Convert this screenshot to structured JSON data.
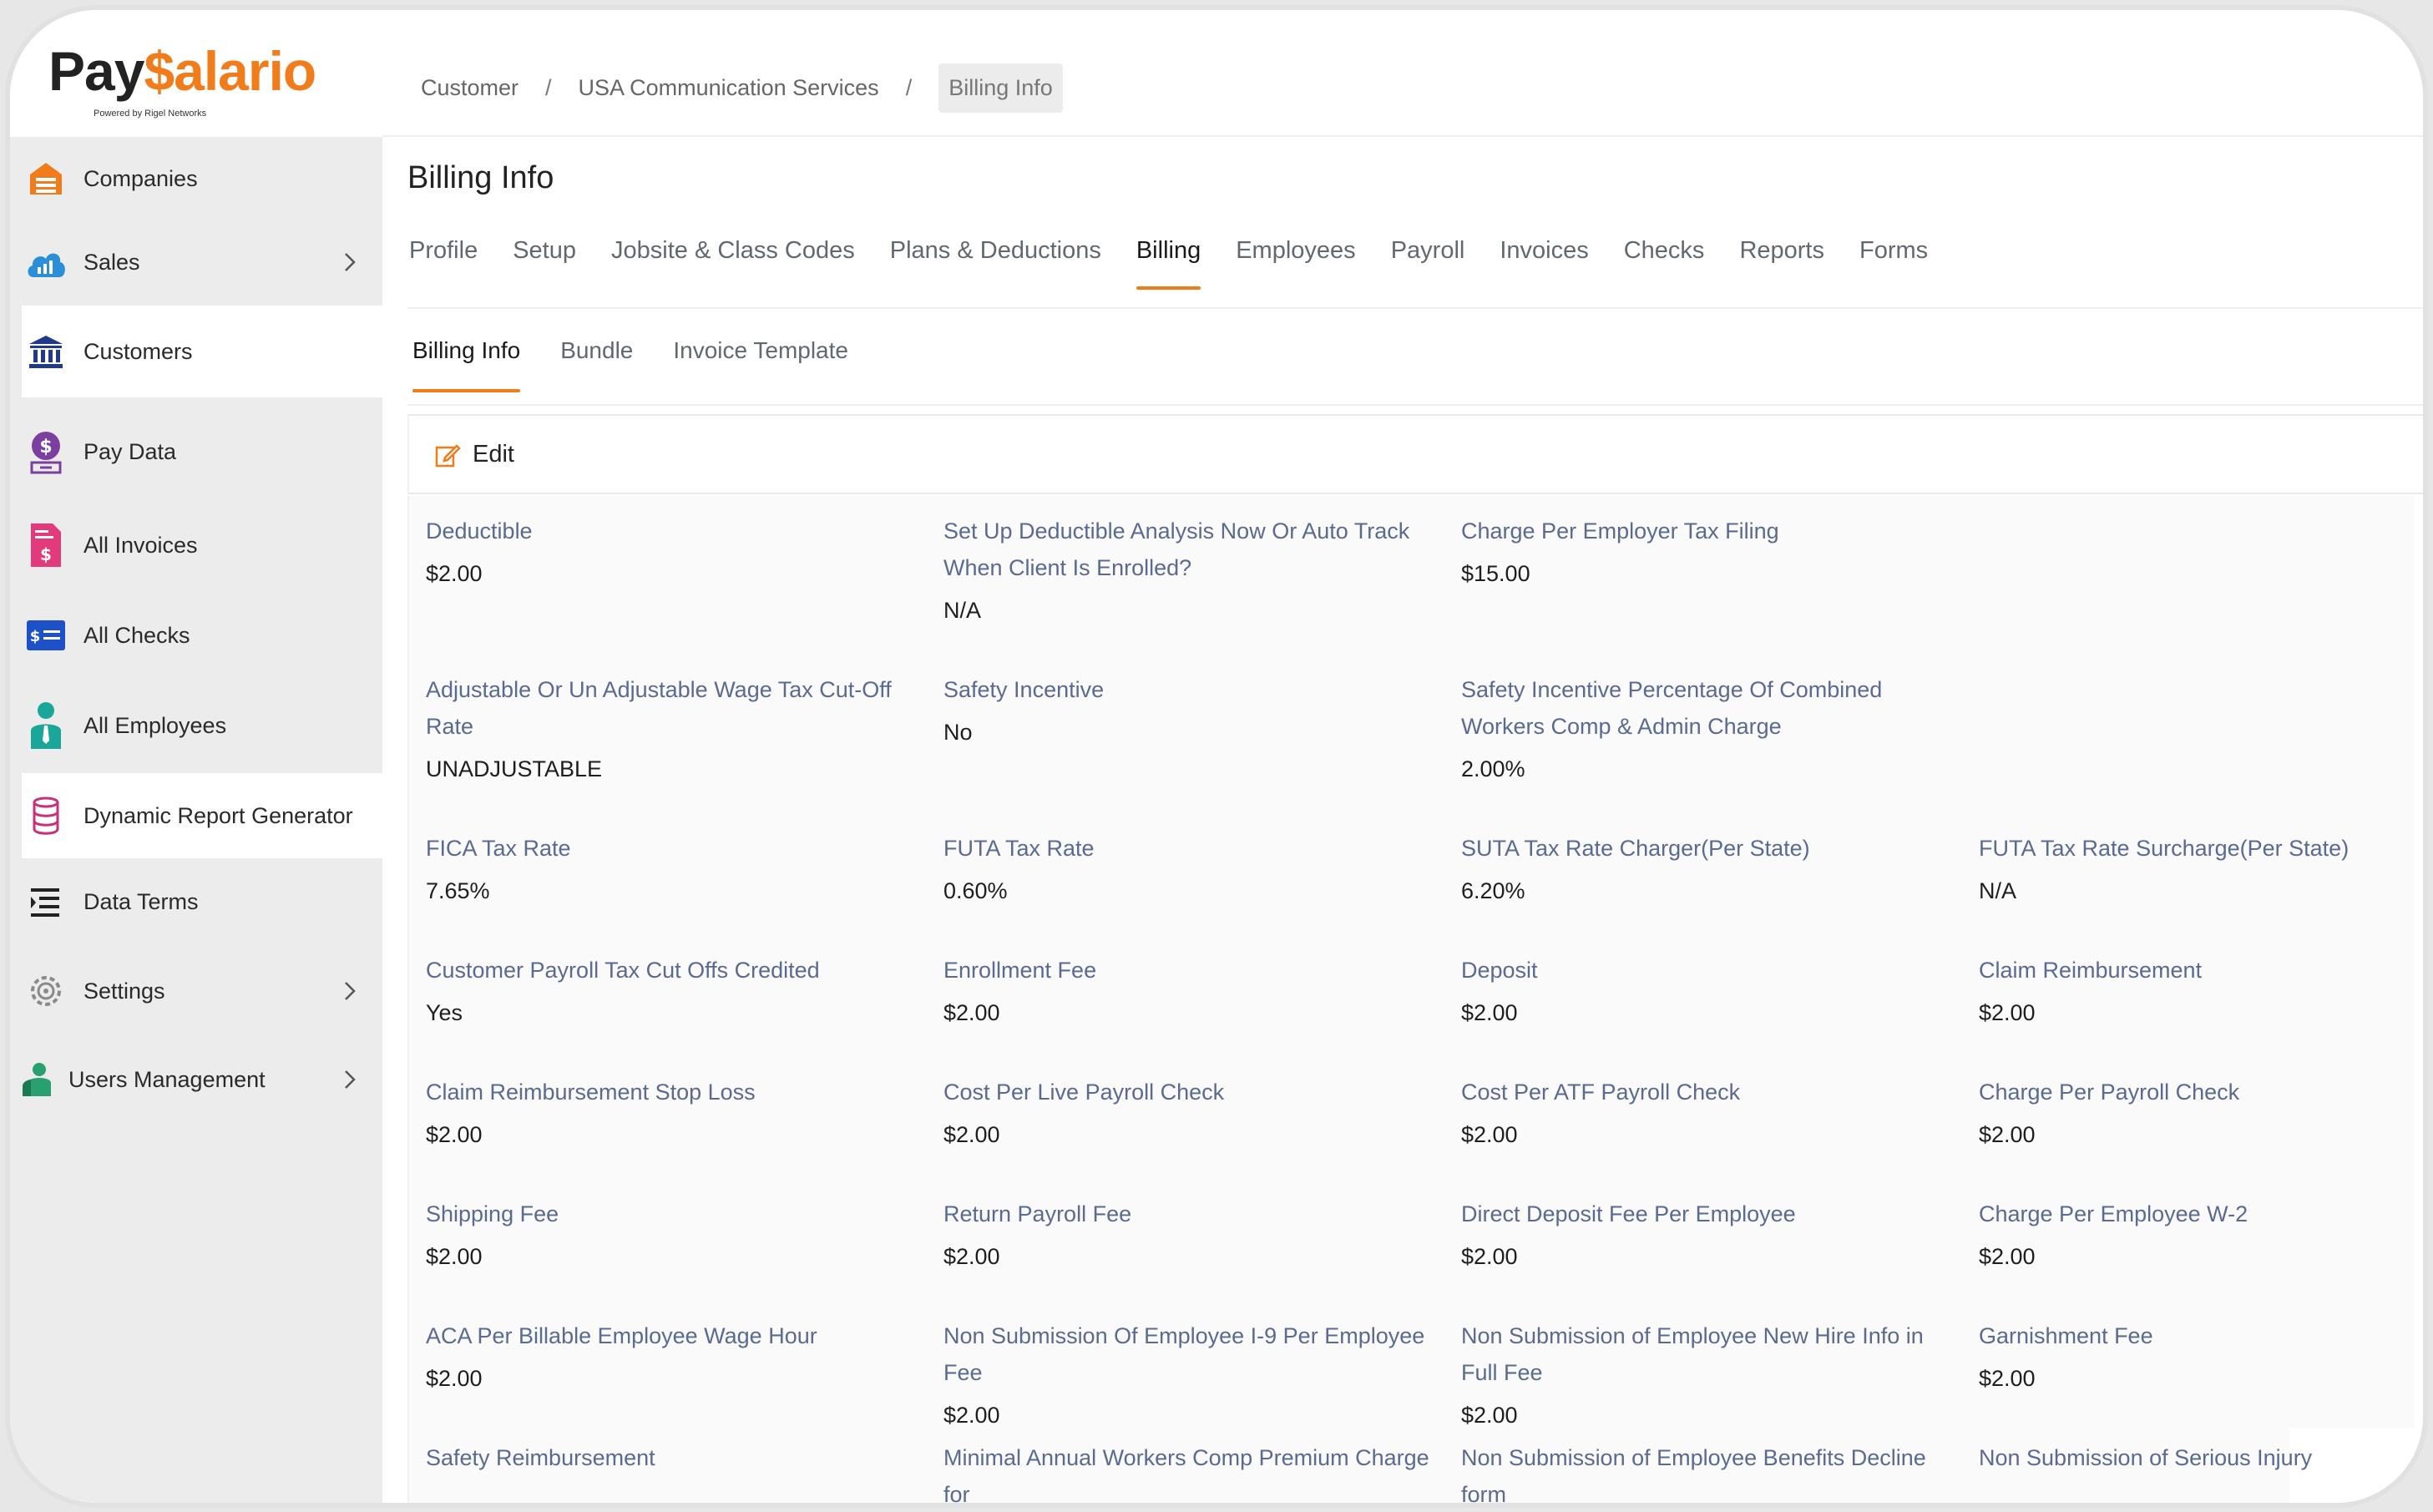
{
  "brand": {
    "name_part1": "Pay",
    "name_part2": "$alario",
    "tagline": "Powered by Rigel Networks"
  },
  "sidebar": {
    "items": [
      {
        "label": "Companies",
        "icon": "building-icon",
        "active": false,
        "chevron": false
      },
      {
        "label": "Sales",
        "icon": "cloud-chart-icon",
        "active": false,
        "chevron": true
      },
      {
        "label": "Customers",
        "icon": "bank-icon",
        "active": true,
        "chevron": false
      },
      {
        "label": "Pay Data",
        "icon": "money-bag-icon",
        "active": false,
        "chevron": false
      },
      {
        "label": "All Invoices",
        "icon": "invoice-icon",
        "active": false,
        "chevron": false
      },
      {
        "label": "All Checks",
        "icon": "check-icon",
        "active": false,
        "chevron": false
      },
      {
        "label": "All Employees",
        "icon": "employee-icon",
        "active": false,
        "chevron": false
      },
      {
        "label": "Dynamic Report Generator",
        "icon": "database-icon",
        "active": true,
        "chevron": false
      },
      {
        "label": "Data Terms",
        "icon": "list-icon",
        "active": false,
        "chevron": false
      },
      {
        "label": "Settings",
        "icon": "gear-icon",
        "active": false,
        "chevron": true
      },
      {
        "label": "Users Management",
        "icon": "users-icon",
        "active": false,
        "chevron": true
      }
    ]
  },
  "breadcrumb": {
    "items": [
      "Customer",
      "USA Communication Services",
      "Billing Info"
    ],
    "separator": "/"
  },
  "page": {
    "title": "Billing Info"
  },
  "tabs": [
    "Profile",
    "Setup",
    "Jobsite & Class Codes",
    "Plans & Deductions",
    "Billing",
    "Employees",
    "Payroll",
    "Invoices",
    "Checks",
    "Reports",
    "Forms"
  ],
  "active_tab": "Billing",
  "subtabs": [
    "Billing Info",
    "Bundle",
    "Invoice Template"
  ],
  "active_subtab": "Billing Info",
  "edit_label": "Edit",
  "fields": [
    {
      "label": "Deductible",
      "value": "$2.00"
    },
    {
      "label": "Set Up Deductible Analysis Now Or Auto Track When Client Is Enrolled?",
      "value": "N/A"
    },
    {
      "label": "Charge Per Employer Tax Filing",
      "value": "$15.00"
    },
    {
      "label": "Adjustable Or Un Adjustable Wage Tax Cut-Off Rate",
      "value": "UNADJUSTABLE"
    },
    {
      "label": "Safety Incentive",
      "value": "No"
    },
    {
      "label": "Safety Incentive Percentage Of Combined Workers Comp & Admin Charge",
      "value": "2.00%"
    },
    {
      "label": "FICA Tax Rate",
      "value": "7.65%"
    },
    {
      "label": "FUTA Tax Rate",
      "value": "0.60%"
    },
    {
      "label": "SUTA Tax Rate Charger(Per State)",
      "value": "6.20%"
    },
    {
      "label": "FUTA Tax Rate Surcharge(Per State)",
      "value": "N/A"
    },
    {
      "label": "Customer Payroll Tax Cut Offs Credited",
      "value": "Yes"
    },
    {
      "label": "Enrollment Fee",
      "value": "$2.00"
    },
    {
      "label": "Deposit",
      "value": "$2.00"
    },
    {
      "label": "Claim Reimbursement",
      "value": "$2.00"
    },
    {
      "label": "Claim Reimbursement Stop Loss",
      "value": "$2.00"
    },
    {
      "label": "Cost Per Live Payroll Check",
      "value": "$2.00"
    },
    {
      "label": "Cost Per ATF Payroll Check",
      "value": "$2.00"
    },
    {
      "label": "Charge Per Payroll Check",
      "value": "$2.00"
    },
    {
      "label": "Shipping Fee",
      "value": "$2.00"
    },
    {
      "label": "Return Payroll Fee",
      "value": "$2.00"
    },
    {
      "label": "Direct Deposit Fee Per Employee",
      "value": "$2.00"
    },
    {
      "label": "Charge Per Employee W-2",
      "value": "$2.00"
    },
    {
      "label": "ACA Per Billable Employee Wage Hour",
      "value": "$2.00"
    },
    {
      "label": "Non Submission Of Employee I-9 Per Employee Fee",
      "value": "$2.00"
    },
    {
      "label": "Non Submission of Employee New Hire Info in Full Fee",
      "value": "$2.00"
    },
    {
      "label": "Garnishment Fee",
      "value": "$2.00"
    },
    {
      "label": "Safety Reimbursement",
      "value": ""
    },
    {
      "label": "Minimal Annual Workers Comp Premium Charge for",
      "value": ""
    },
    {
      "label": "Non Submission of Employee Benefits Decline form",
      "value": ""
    },
    {
      "label": "Non Submission of Serious Injury",
      "value": ""
    }
  ],
  "colors": {
    "accent": "#f07c1b",
    "label": "#5a6a90",
    "sidebar_bg": "#ececec"
  }
}
